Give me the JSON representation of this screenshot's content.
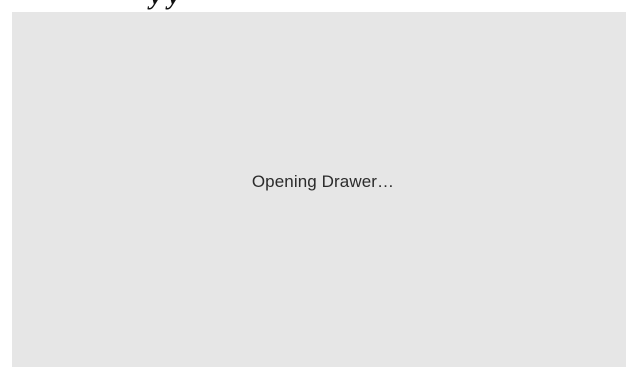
{
  "header": {
    "heading_fragment": "y y"
  },
  "drawer": {
    "status_text": "Opening Drawer…",
    "background_color": "#e6e6e6"
  }
}
